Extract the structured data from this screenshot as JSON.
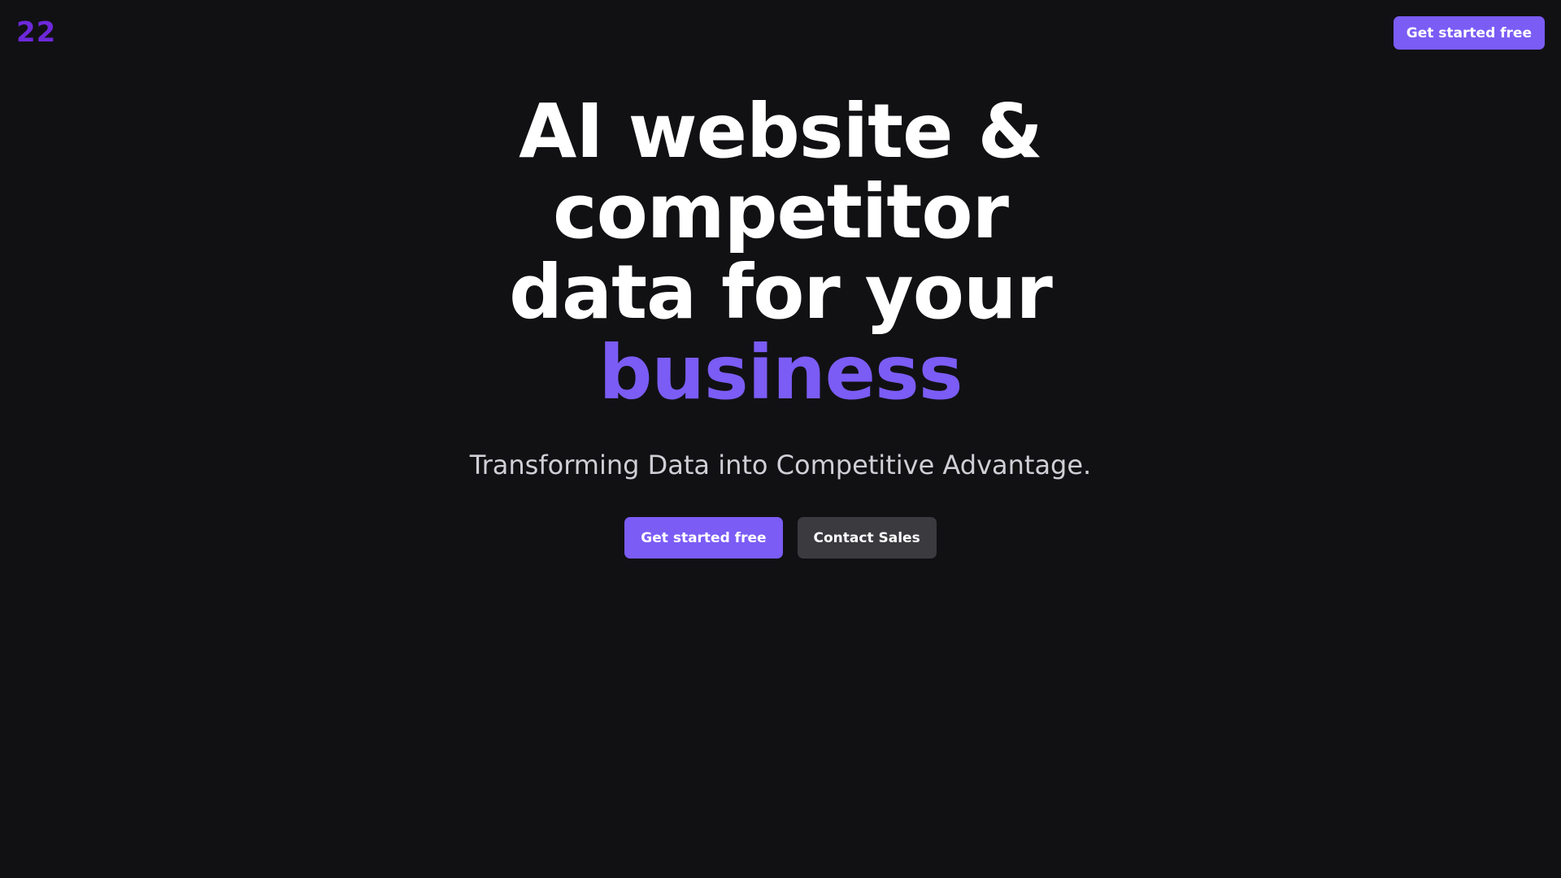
{
  "header": {
    "logo_text": "22",
    "cta_label": "Get started free"
  },
  "hero": {
    "headline_line1": "AI website &",
    "headline_line2": "competitor",
    "headline_line3": "data for your",
    "headline_accent": "business",
    "subtitle": "Transforming Data into Competitive Advantage.",
    "primary_button": "Get started free",
    "secondary_button": "Contact Sales"
  },
  "colors": {
    "background": "#111114",
    "accent": "#7b5cf5",
    "logo": "#6d28d9",
    "secondary_button": "#3a3a3f",
    "text": "#ffffff",
    "subtitle_text": "#cfcfd6"
  }
}
